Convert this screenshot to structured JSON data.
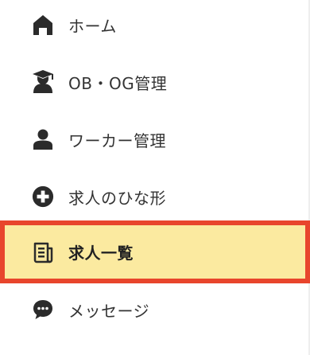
{
  "nav": {
    "items": [
      {
        "label": "ホーム",
        "icon": "home-icon"
      },
      {
        "label": "OB・OG管理",
        "icon": "graduate-icon"
      },
      {
        "label": "ワーカー管理",
        "icon": "person-icon"
      },
      {
        "label": "求人のひな形",
        "icon": "plus-circle-icon"
      },
      {
        "label": "求人一覧",
        "icon": "document-list-icon",
        "active": true
      },
      {
        "label": "メッセージ",
        "icon": "chat-bubble-icon"
      }
    ]
  },
  "colors": {
    "active_background": "#fbeaa0",
    "active_border": "#e8452c",
    "text": "#333333",
    "icon": "#2b2b2b"
  }
}
